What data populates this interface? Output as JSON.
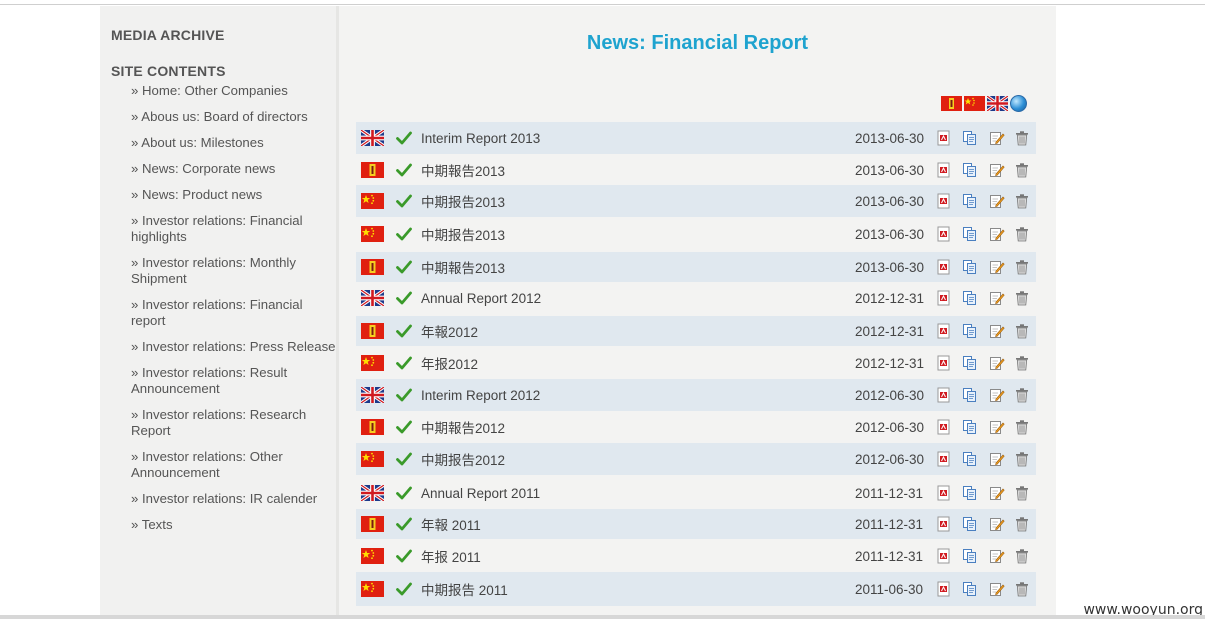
{
  "sidebar": {
    "media_archive": "MEDIA ARCHIVE",
    "site_contents": "SITE CONTENTS",
    "items": [
      {
        "label": "» Home: Other Companies"
      },
      {
        "label": "» Abous us: Board of directors"
      },
      {
        "label": "» About us: Milestones"
      },
      {
        "label": "» News: Corporate news"
      },
      {
        "label": "» News: Product news"
      },
      {
        "label": "» Investor relations: Financial highlights"
      },
      {
        "label": "» Investor relations: Monthly Shipment"
      },
      {
        "label": "» Investor relations: Financial report"
      },
      {
        "label": "» Investor relations: Press Release"
      },
      {
        "label": "» Investor relations: Result Announcement"
      },
      {
        "label": "» Investor relations: Research Report"
      },
      {
        "label": "» Investor relations: Other Announcement"
      },
      {
        "label": "» Investor relations: IR calender"
      },
      {
        "label": "» Texts"
      }
    ]
  },
  "main": {
    "title": "News: Financial Report",
    "languages": [
      "flag-cn-traditional-icon",
      "flag-cn-simplified-icon",
      "flag-uk-icon",
      "globe-icon"
    ],
    "rows": [
      {
        "lang": "uk",
        "title": "Interim Report 2013",
        "date": "2013-06-30"
      },
      {
        "lang": "tw",
        "title": "中期報告2013",
        "date": "2013-06-30"
      },
      {
        "lang": "cn",
        "title": "中期报告2013",
        "date": "2013-06-30"
      },
      {
        "lang": "cn",
        "title": "中期报告2013",
        "date": "2013-06-30"
      },
      {
        "lang": "tw",
        "title": "中期報告2013",
        "date": "2013-06-30"
      },
      {
        "lang": "uk",
        "title": "Annual Report 2012",
        "date": "2012-12-31"
      },
      {
        "lang": "tw",
        "title": "年報2012",
        "date": "2012-12-31"
      },
      {
        "lang": "cn",
        "title": "年报2012",
        "date": "2012-12-31"
      },
      {
        "lang": "uk",
        "title": "Interim Report 2012",
        "date": "2012-06-30"
      },
      {
        "lang": "tw",
        "title": "中期報告2012",
        "date": "2012-06-30"
      },
      {
        "lang": "cn",
        "title": "中期报告2012",
        "date": "2012-06-30"
      },
      {
        "lang": "uk",
        "title": "Annual Report 2011",
        "date": "2011-12-31"
      },
      {
        "lang": "tw",
        "title": "年報 2011",
        "date": "2011-12-31"
      },
      {
        "lang": "cn",
        "title": "年报 2011",
        "date": "2011-12-31"
      },
      {
        "lang": "cn",
        "title": "中期报告 2011",
        "date": "2011-06-30"
      }
    ]
  },
  "watermark": "www.wooyun.org",
  "colors": {
    "title": "#1ea3cf",
    "row_shade": "#e0e8ef",
    "check": "#3a9a2a"
  }
}
